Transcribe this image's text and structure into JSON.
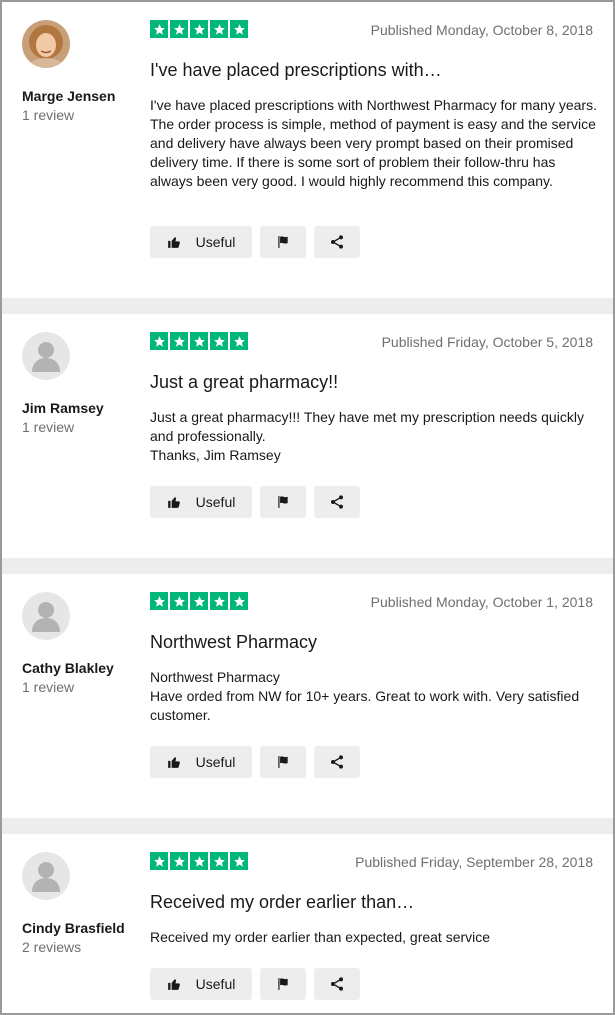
{
  "colors": {
    "star_green": "#00b67a",
    "button_bg": "#ededed",
    "separator": "#ededed"
  },
  "reviews": [
    {
      "reviewer": "Marge Jensen",
      "review_count": "1 review",
      "rating": 5,
      "avatar": "photo",
      "date": "Published Monday, October 8, 2018",
      "title": "I've have placed prescriptions with…",
      "body": [
        "I've have placed prescriptions with Northwest Pharmacy for many years. The order process is simple, method of payment is easy and the service and delivery have always been very prompt based on their promised delivery time. If there is some sort of problem their follow-thru has always been very good. I would highly recommend this company."
      ],
      "useful_label": "Useful"
    },
    {
      "reviewer": "Jim Ramsey",
      "review_count": "1 review",
      "rating": 5,
      "avatar": "placeholder",
      "date": "Published Friday, October 5, 2018",
      "title": "Just a great pharmacy!!",
      "body": [
        "Just a great pharmacy!!! They have met my prescription needs quickly and professionally.",
        "Thanks, Jim Ramsey"
      ],
      "useful_label": "Useful"
    },
    {
      "reviewer": "Cathy Blakley",
      "review_count": "1 review",
      "rating": 5,
      "avatar": "placeholder",
      "date": "Published Monday, October 1, 2018",
      "title": "Northwest Pharmacy",
      "body": [
        "Northwest Pharmacy",
        "Have orded from NW for 10+ years. Great to work with. Very satisfied customer."
      ],
      "useful_label": "Useful"
    },
    {
      "reviewer": "Cindy Brasfield",
      "review_count": "2 reviews",
      "rating": 5,
      "avatar": "placeholder",
      "date": "Published Friday, September 28, 2018",
      "title": "Received my order earlier than…",
      "body": [
        "Received my order earlier than expected, great service"
      ],
      "useful_label": "Useful"
    }
  ]
}
